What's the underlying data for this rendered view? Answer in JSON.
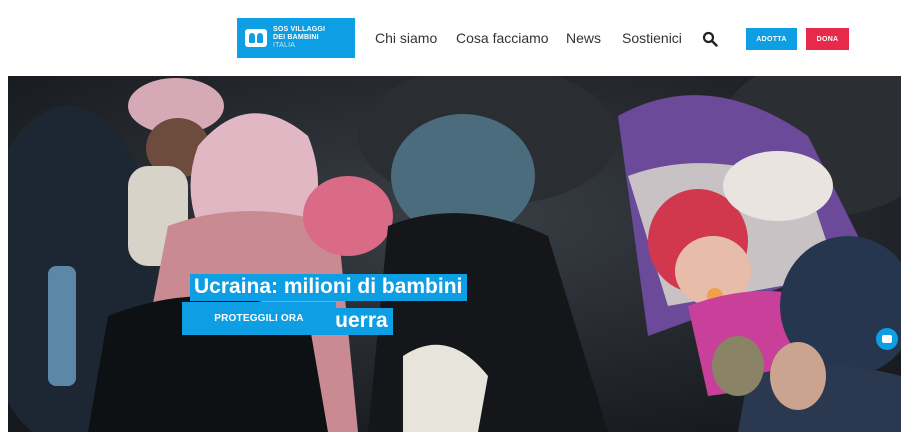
{
  "header": {
    "logo": {
      "line1": "SOS VILLAGGI",
      "line2": "DEI BAMBINI",
      "line3": "ITALIA"
    },
    "nav": [
      {
        "label": "Chi siamo"
      },
      {
        "label": "Cosa facciamo"
      },
      {
        "label": "News"
      },
      {
        "label": "Sostienici"
      }
    ],
    "adopt_label": "ADOTTA",
    "donate_label": "DONA"
  },
  "hero": {
    "headline_line1": "Ucraina: milioni di bambini",
    "headline_line2": "in fuga dalla guerra",
    "cta_label": "PROTEGGILI ORA"
  },
  "colors": {
    "brand_blue": "#0d9ee3",
    "donate_red": "#e7294b"
  }
}
